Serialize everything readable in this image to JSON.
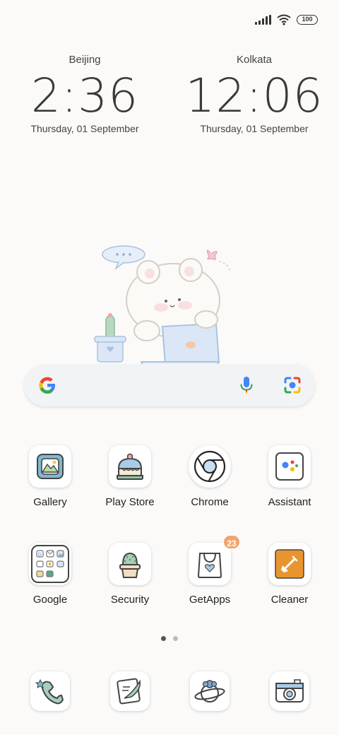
{
  "status_bar": {
    "battery": "100",
    "icons": [
      "signal-icon",
      "wifi-icon",
      "battery-icon"
    ]
  },
  "clocks": [
    {
      "city": "Beijing",
      "time": "2:36",
      "date": "Thursday, 01 September"
    },
    {
      "city": "Kolkata",
      "time": "12:06",
      "date": "Thursday, 01 September"
    }
  ],
  "search": {
    "icons": [
      "google-g-icon",
      "mic-icon",
      "lens-icon"
    ]
  },
  "apps": [
    {
      "label": "Gallery",
      "icon": "gallery-icon"
    },
    {
      "label": "Play Store",
      "icon": "cake-icon"
    },
    {
      "label": "Chrome",
      "icon": "chrome-icon"
    },
    {
      "label": "Assistant",
      "icon": "assistant-icon"
    },
    {
      "label": "Google",
      "icon": "google-folder-icon"
    },
    {
      "label": "Security",
      "icon": "cactus-icon"
    },
    {
      "label": "GetApps",
      "icon": "bag-icon",
      "badge": "23"
    },
    {
      "label": "Cleaner",
      "icon": "broom-icon"
    }
  ],
  "pages": {
    "count": 2,
    "active": 1
  },
  "dock": [
    {
      "icon": "phone-icon"
    },
    {
      "icon": "message-icon"
    },
    {
      "icon": "browser-planet-icon"
    },
    {
      "icon": "camera-icon"
    }
  ],
  "colors": {
    "background": "#fbfaf8",
    "badge": "#f4a36e",
    "cleaner": "#e9952f"
  }
}
